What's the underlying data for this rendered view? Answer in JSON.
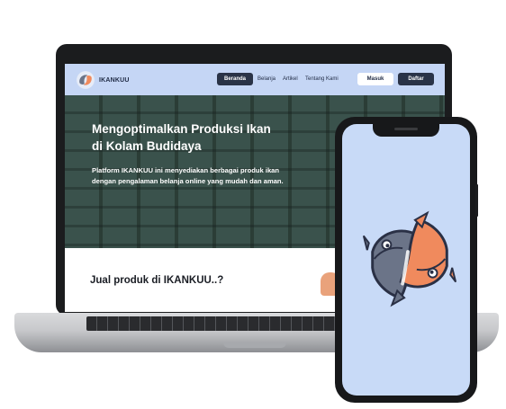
{
  "site": {
    "brand_name": "IKANKUU",
    "nav": {
      "beranda": "Beranda",
      "belanja": "Belanja",
      "artikel": "Artikel",
      "tentang": "Tentang Kami",
      "masuk": "Masuk",
      "daftar": "Daftar"
    },
    "hero": {
      "title_line1": "Mengoptimalkan Produksi Ikan",
      "title_line2": "di Kolam Budidaya",
      "description": "Platform IKANKUU ini menyediakan berbagai produk ikan dengan pengalaman belanja online yang mudah dan aman."
    },
    "section_heading": "Jual produk di IKANKUU..?"
  },
  "colors": {
    "navbar": "#c5d6f5",
    "dark_button": "#2a3347",
    "phone_screen": "#c8daf7",
    "fish_grey": "#6b7488",
    "fish_orange": "#f08a5d"
  },
  "icons": {
    "brand_logo": "fish-yin-yang-icon",
    "phone_logo": "fish-yin-yang-icon"
  }
}
